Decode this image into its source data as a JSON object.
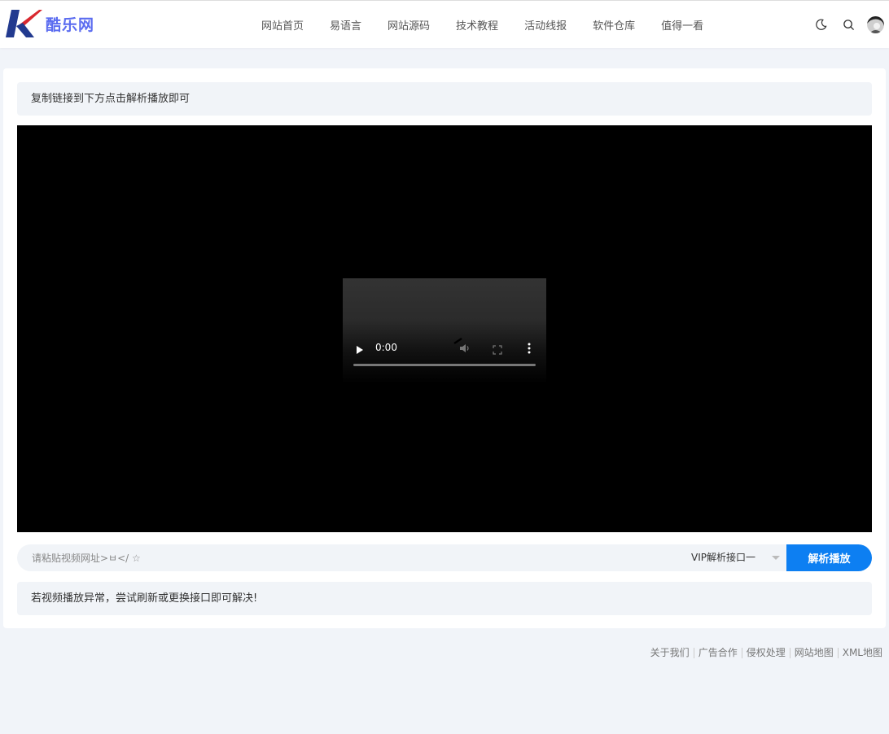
{
  "header": {
    "logo_text": "酷乐网",
    "nav": [
      "网站首页",
      "易语言",
      "网站源码",
      "技术教程",
      "活动线报",
      "软件仓库",
      "值得一看"
    ]
  },
  "main": {
    "tip_top": "复制链接到下方点击解析播放即可",
    "player": {
      "time": "0:00",
      "progress": 0
    },
    "url_placeholder": "请粘贴视频网址>ㅂ</ ☆",
    "api_selected": "VIP解析接口一",
    "submit_label": "解析播放",
    "tip_bottom": "若视频播放异常，尝试刷新或更换接口即可解决!"
  },
  "footer": {
    "links": [
      "关于我们",
      "广告合作",
      "侵权处理",
      "网站地图",
      "XML地图"
    ]
  },
  "colors": {
    "accent": "#0d7ff2",
    "logo_red": "#d9282f",
    "logo_navy": "#223a8f",
    "logo_text": "#5b6cf0",
    "page_bg": "#f1f4f9"
  }
}
